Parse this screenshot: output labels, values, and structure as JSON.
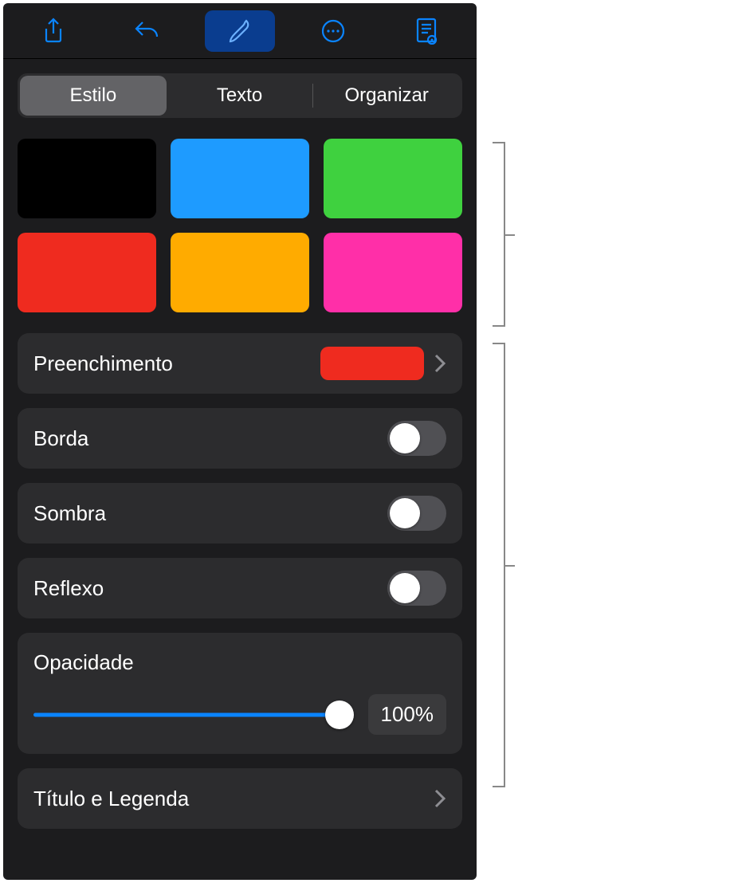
{
  "toolbar": {
    "icons": [
      "share-icon",
      "undo-icon",
      "format-brush-icon",
      "more-icon",
      "presenter-notes-icon"
    ],
    "active_index": 2
  },
  "tabs": {
    "items": [
      "Estilo",
      "Texto",
      "Organizar"
    ],
    "selected_index": 0
  },
  "swatches": [
    {
      "name": "black",
      "color": "#000000"
    },
    {
      "name": "blue",
      "color": "#1e9bff"
    },
    {
      "name": "green",
      "color": "#3fd13f"
    },
    {
      "name": "red",
      "color": "#ef2b1f"
    },
    {
      "name": "orange",
      "color": "#ffab00"
    },
    {
      "name": "magenta",
      "color": "#ff2fa8"
    }
  ],
  "fill": {
    "label": "Preenchimento",
    "color": "#ef2b1f"
  },
  "toggles": {
    "border": {
      "label": "Borda",
      "on": false
    },
    "shadow": {
      "label": "Sombra",
      "on": false
    },
    "reflect": {
      "label": "Reflexo",
      "on": false
    }
  },
  "opacity": {
    "label": "Opacidade",
    "value_text": "100%",
    "value": 100
  },
  "title_caption": {
    "label": "Título e Legenda"
  },
  "accent": "#0a84ff"
}
